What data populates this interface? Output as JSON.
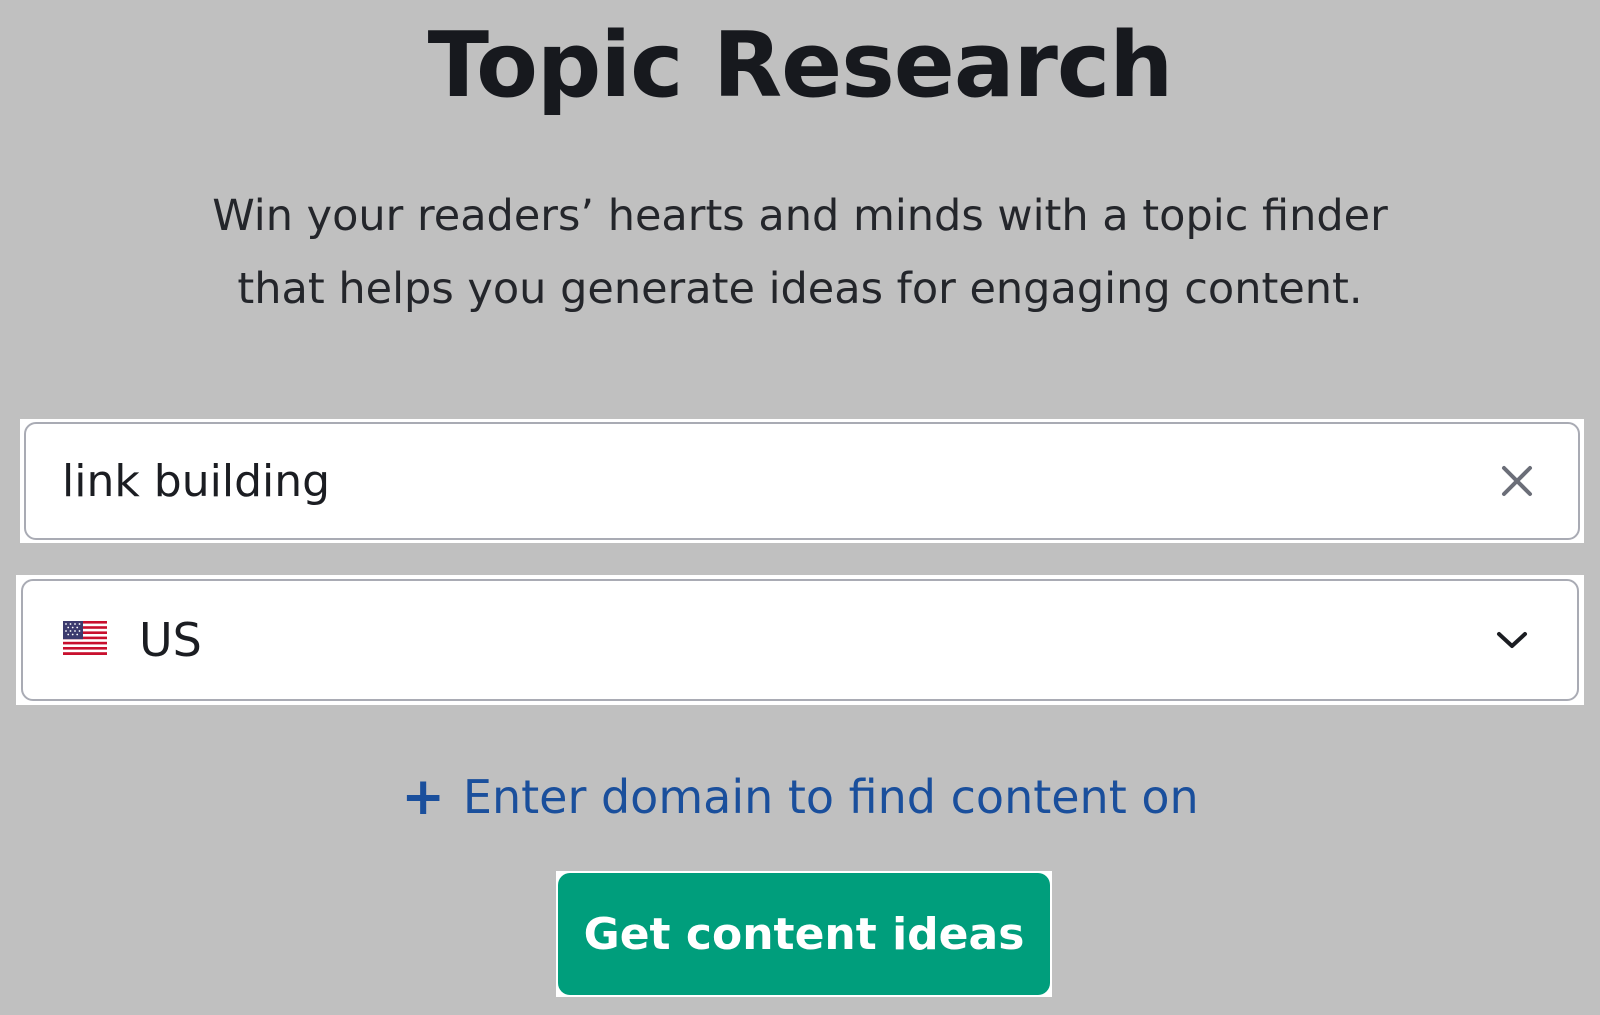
{
  "header": {
    "title": "Topic Research",
    "subtitle_line1": "Win your readers’ hearts and minds with a topic finder",
    "subtitle_line2": "that helps you generate ideas for engaging content."
  },
  "form": {
    "keyword": {
      "value": "link building",
      "clear_icon": "close-icon"
    },
    "country": {
      "selected": "US",
      "flag_icon": "us-flag-icon",
      "dropdown_icon": "chevron-down-icon"
    },
    "domain_link": {
      "icon": "plus-icon",
      "icon_glyph": "+",
      "label": "Enter domain to find content on"
    },
    "submit_label": "Get content ideas"
  },
  "colors": {
    "background": "#c0c0c0",
    "link": "#1a4f9c",
    "button": "#009e7c",
    "field_border": "#a9abb4"
  }
}
